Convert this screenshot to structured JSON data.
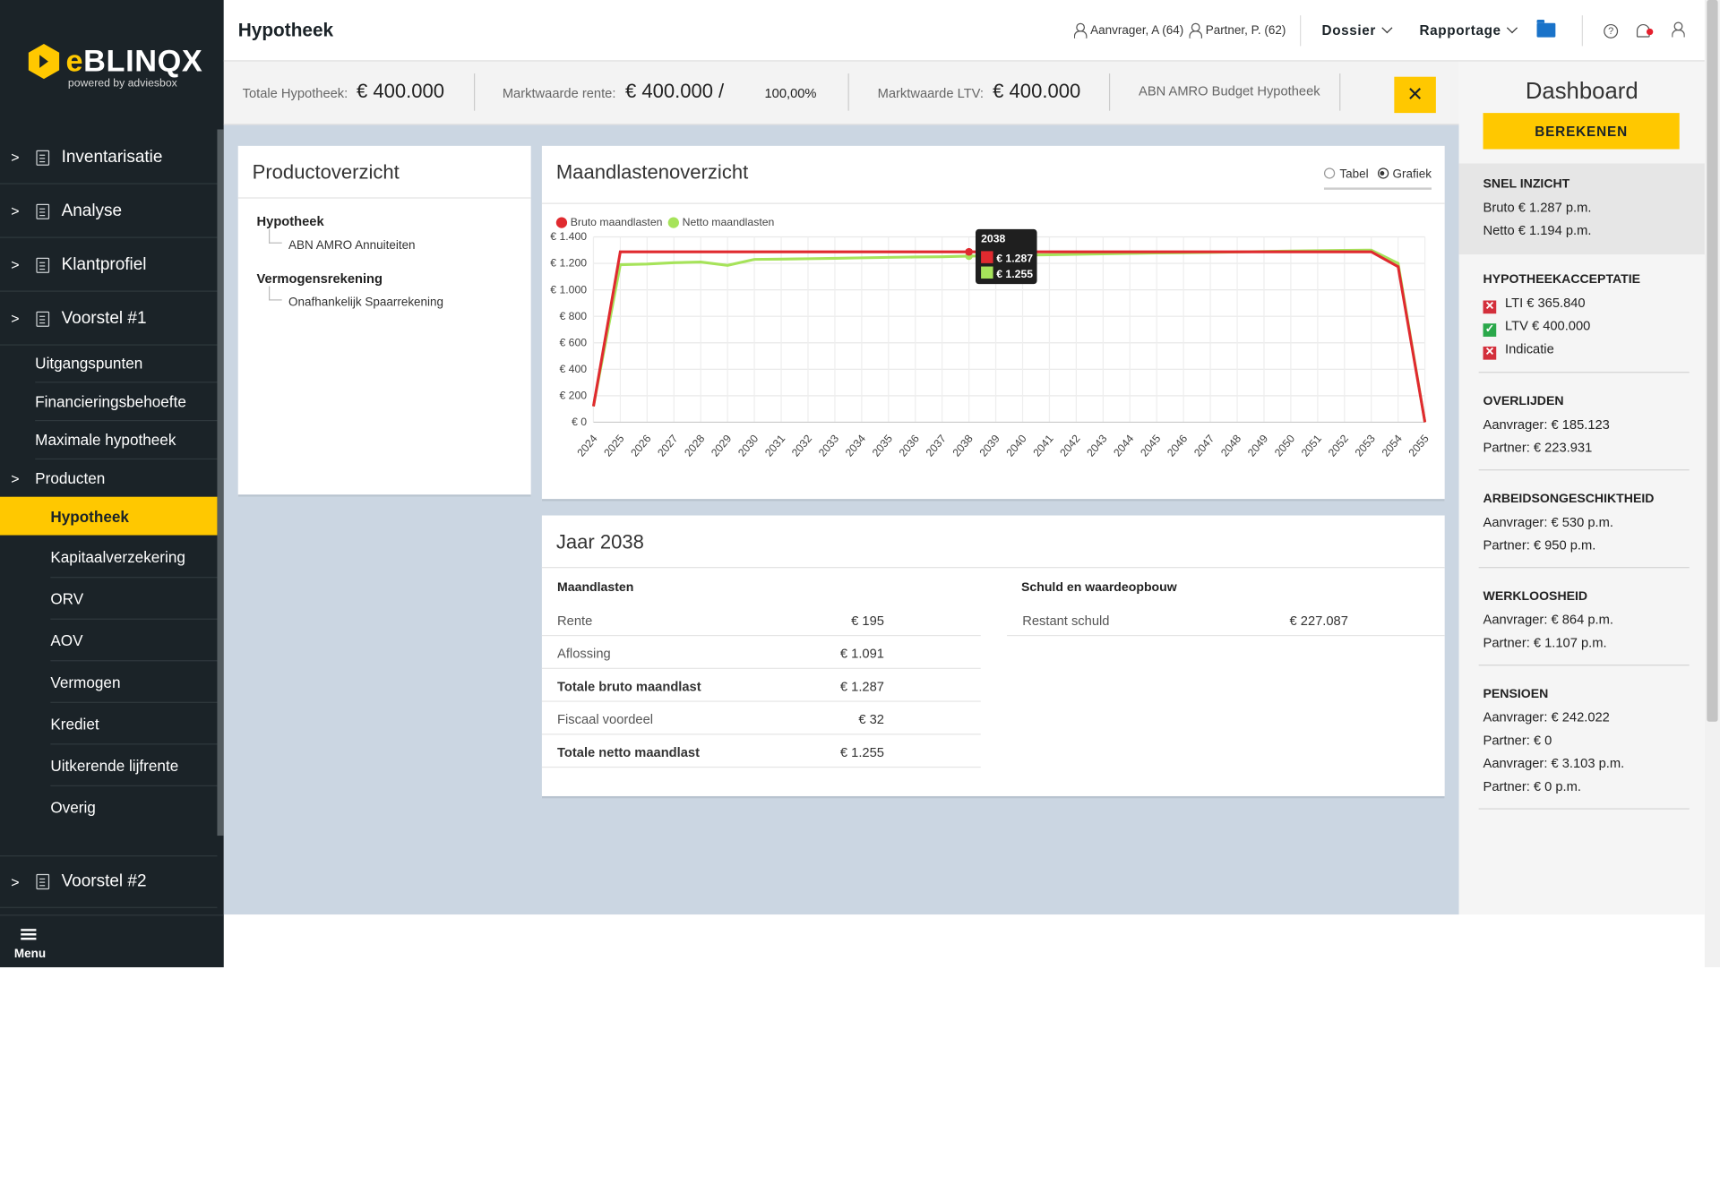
{
  "header": {
    "title": "Hypotheek",
    "aanvrager": "Aanvrager, A (64)",
    "partner": "Partner, P. (62)",
    "dossier": "Dossier",
    "rapportage": "Rapportage",
    "help_icon": "?"
  },
  "logo": {
    "brand_e": "e",
    "brand_rest": "BLINQX",
    "sub": "powered by adviesbox"
  },
  "sidebar": {
    "main_items": [
      {
        "label": "Inventarisatie",
        "icon": "document-icon"
      },
      {
        "label": "Analyse",
        "icon": "checklist-icon"
      },
      {
        "label": "Klantprofiel",
        "icon": "profile-icon"
      },
      {
        "label": "Voorstel #1",
        "icon": "document-icon"
      }
    ],
    "sub_items": [
      "Uitgangspunten",
      "Financieringsbehoefte",
      "Maximale hypotheek",
      "Producten"
    ],
    "product_items": [
      "Hypotheek",
      "Kapitaalverzekering",
      "ORV",
      "AOV",
      "Vermogen",
      "Krediet",
      "Uitkerende lijfrente",
      "Overig"
    ],
    "voorstel2": "Voorstel #2",
    "menu": "Menu"
  },
  "summary": {
    "totale_label": "Totale Hypotheek:",
    "totale_value": "€ 400.000",
    "marktwaarde_rente_label": "Marktwaarde rente:",
    "marktwaarde_rente_value": "€ 400.000",
    "slash": "/",
    "percentage": "100,00%",
    "ltv_label": "Marktwaarde LTV:",
    "ltv_value": "€ 400.000",
    "product": "ABN AMRO Budget Hypotheek",
    "close": "✕"
  },
  "product": {
    "title": "Productoverzicht",
    "groups": [
      {
        "head": "Hypotheek",
        "item": "ABN AMRO Annuiteiten"
      },
      {
        "head": "Vermogensrekening",
        "item": "Onafhankelijk Spaarrekening"
      }
    ]
  },
  "maandlasten": {
    "title": "Maandlastenoverzicht",
    "radio_tabel": "Tabel",
    "radio_grafiek": "Grafiek",
    "tooltip": {
      "year": "2038",
      "bruto": "€ 1.287",
      "netto": "€ 1.255"
    }
  },
  "chart_data": {
    "type": "line",
    "x": [
      "2024",
      "2025",
      "2026",
      "2027",
      "2028",
      "2029",
      "2030",
      "2031",
      "2032",
      "2033",
      "2034",
      "2035",
      "2036",
      "2037",
      "2038",
      "2039",
      "2040",
      "2041",
      "2042",
      "2043",
      "2044",
      "2045",
      "2046",
      "2047",
      "2048",
      "2049",
      "2050",
      "2051",
      "2052",
      "2053",
      "2054",
      "2055"
    ],
    "series": [
      {
        "name": "Bruto maandlasten",
        "color": "#e02a2f",
        "values": [
          120,
          1287,
          1287,
          1287,
          1287,
          1287,
          1287,
          1287,
          1287,
          1287,
          1287,
          1287,
          1287,
          1287,
          1287,
          1287,
          1287,
          1287,
          1287,
          1287,
          1287,
          1287,
          1287,
          1287,
          1287,
          1287,
          1287,
          1287,
          1287,
          1287,
          1175,
          0
        ]
      },
      {
        "name": "Netto maandlasten",
        "color": "#a6e35a",
        "values": [
          120,
          1190,
          1195,
          1205,
          1210,
          1185,
          1230,
          1232,
          1235,
          1238,
          1242,
          1245,
          1248,
          1250,
          1255,
          1258,
          1262,
          1265,
          1268,
          1272,
          1275,
          1278,
          1280,
          1283,
          1286,
          1290,
          1293,
          1296,
          1298,
          1300,
          1200,
          0
        ]
      }
    ],
    "yticks": [
      "€ 0",
      "€ 200",
      "€ 400",
      "€ 600",
      "€ 800",
      "€ 1.000",
      "€ 1.200",
      "€ 1.400"
    ],
    "ylim": [
      0,
      1400
    ],
    "legend": "top-left",
    "grid": true
  },
  "jaar": {
    "title": "Jaar 2038",
    "left_head": "Maandlasten",
    "right_head": "Schuld en waardeopbouw",
    "rows": [
      {
        "k": "Rente",
        "v": "€ 195",
        "bold": false
      },
      {
        "k": "Aflossing",
        "v": "€ 1.091",
        "bold": false
      },
      {
        "k": "Totale bruto maandlast",
        "v": "€ 1.287",
        "bold": true
      },
      {
        "k": "Fiscaal voordeel",
        "v": "€ 32",
        "bold": false
      },
      {
        "k": "Totale netto maandlast",
        "v": "€ 1.255",
        "bold": true
      }
    ],
    "right_rows": [
      {
        "k": "Restant schuld",
        "v": "€ 227.087"
      }
    ]
  },
  "dashboard": {
    "title": "Dashboard",
    "button": "BEREKENEN",
    "snel": {
      "head": "SNEL INZICHT",
      "lines": [
        "Bruto € 1.287 p.m.",
        "Netto € 1.194 p.m."
      ]
    },
    "acceptatie": {
      "head": "HYPOTHEEKACCEPTATIE",
      "items": [
        {
          "label": "LTI € 365.840",
          "ok": false
        },
        {
          "label": "LTV € 400.000",
          "ok": true
        },
        {
          "label": "Indicatie",
          "ok": false
        }
      ]
    },
    "overlijden": {
      "head": "OVERLIJDEN",
      "lines": [
        "Aanvrager: € 185.123",
        "Partner: € 223.931"
      ]
    },
    "ao": {
      "head": "ARBEIDSONGESCHIKTHEID",
      "lines": [
        "Aanvrager: € 530 p.m.",
        "Partner: € 950 p.m."
      ]
    },
    "ww": {
      "head": "WERKLOOSHEID",
      "lines": [
        "Aanvrager: € 864 p.m.",
        "Partner: € 1.107 p.m."
      ]
    },
    "pensioen": {
      "head": "PENSIOEN",
      "lines": [
        "Aanvrager: € 242.022",
        "Partner: € 0",
        "Aanvrager: € 3.103 p.m.",
        "Partner: € 0 p.m."
      ]
    }
  }
}
